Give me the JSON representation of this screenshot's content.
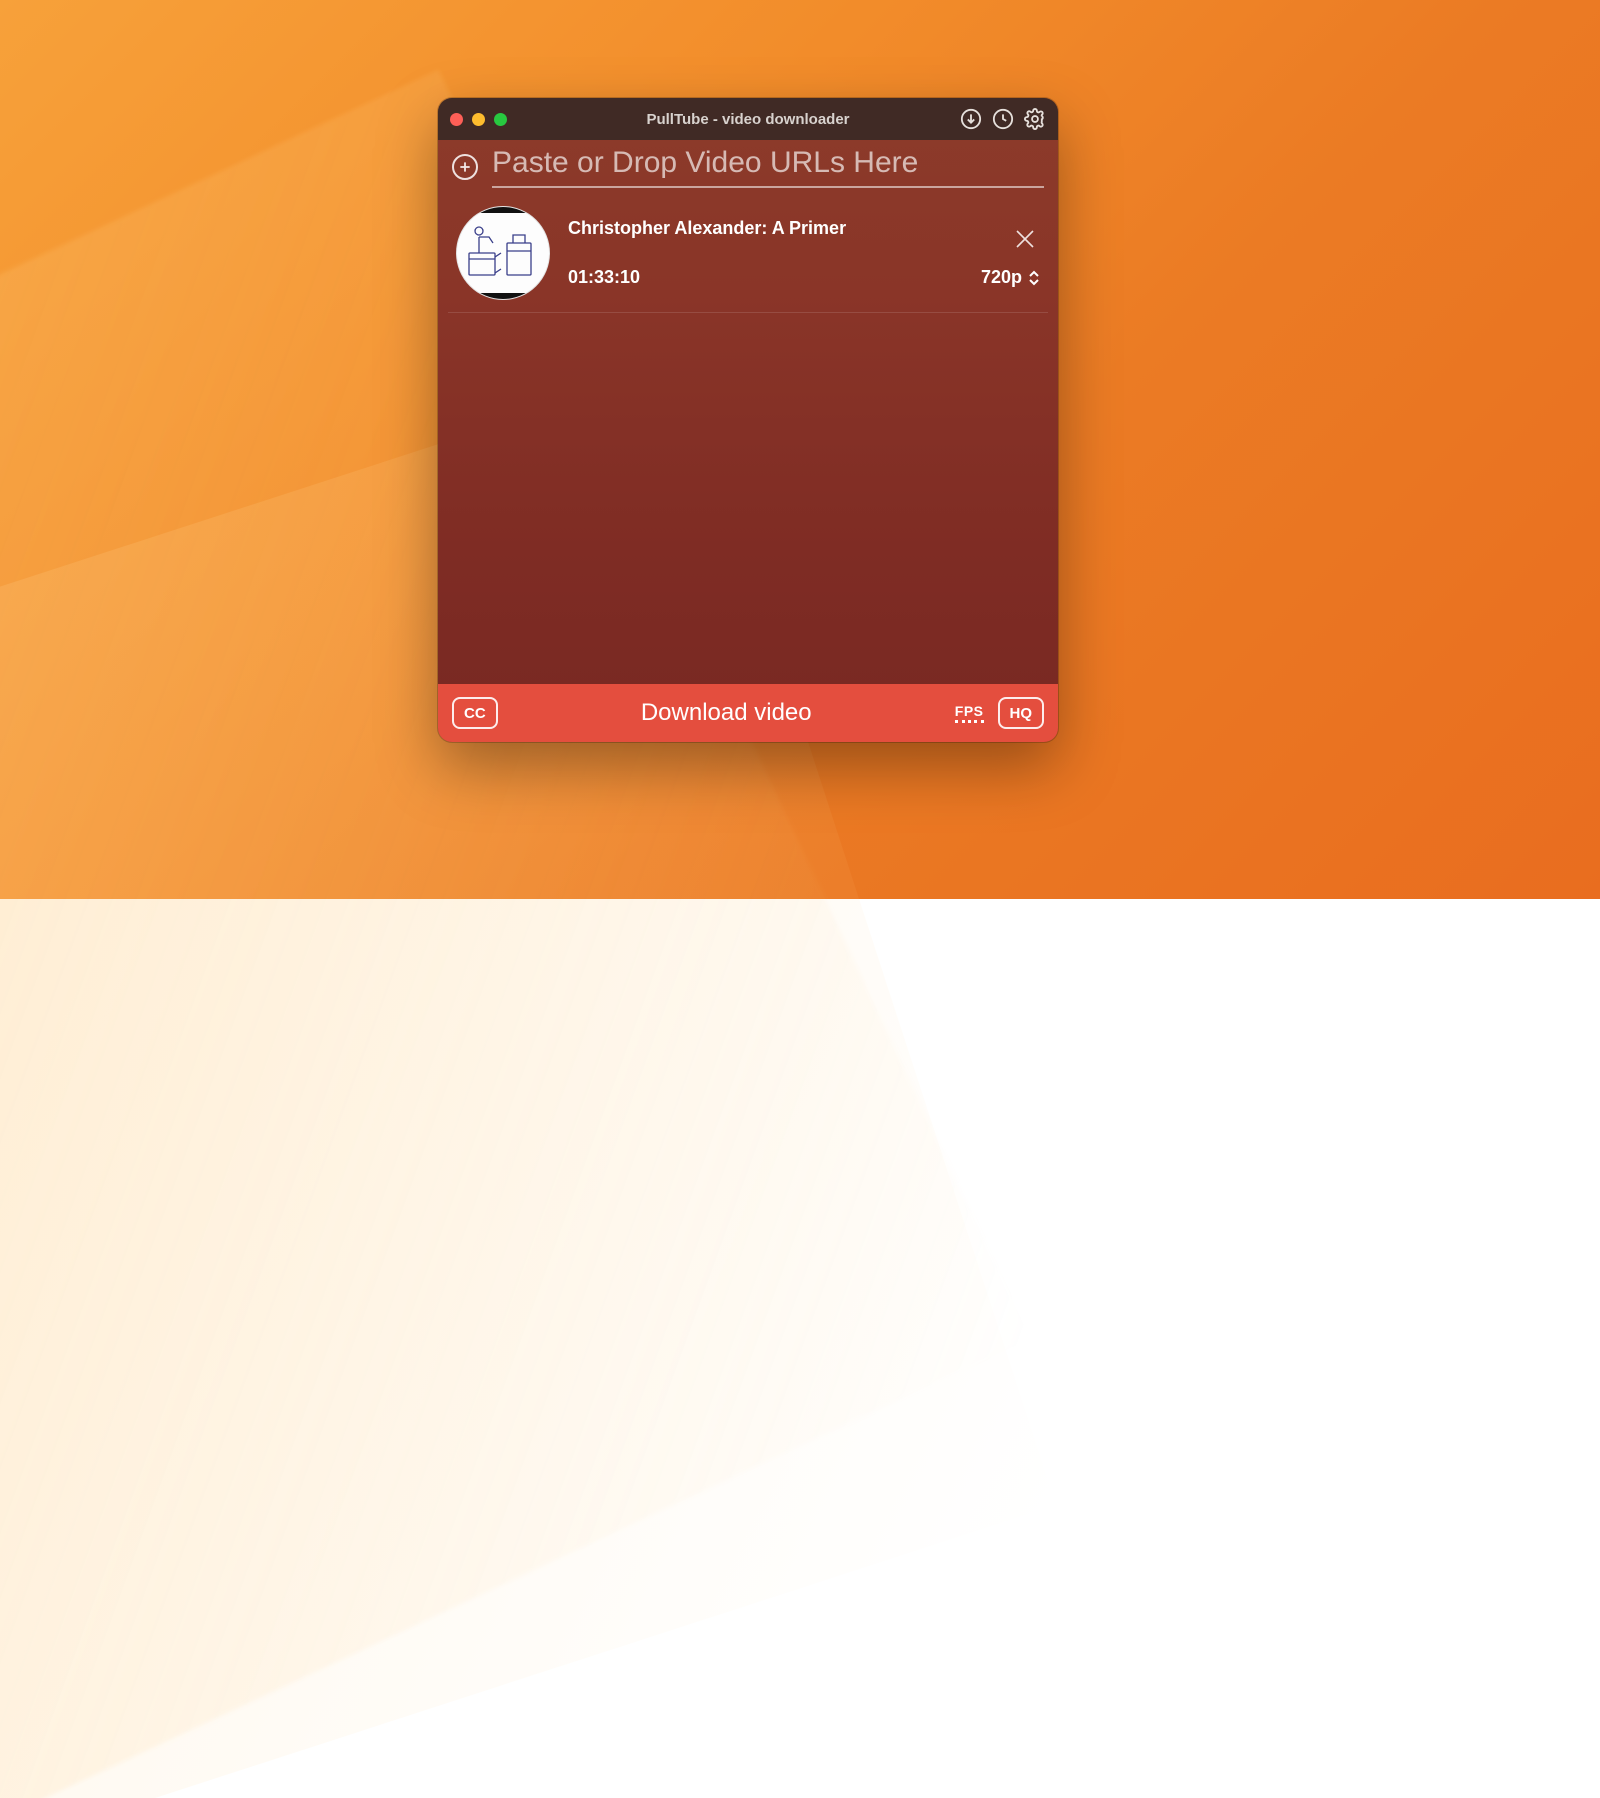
{
  "titlebar": {
    "title": "PullTube - video downloader"
  },
  "url_row": {
    "placeholder": "Paste or Drop Video URLs Here"
  },
  "items": [
    {
      "title": "Christopher Alexander: A Primer",
      "duration": "01:33:10",
      "quality": "720p"
    }
  ],
  "footer": {
    "cc_label": "CC",
    "download_label": "Download video",
    "fps_label": "FPS",
    "hq_label": "HQ"
  }
}
